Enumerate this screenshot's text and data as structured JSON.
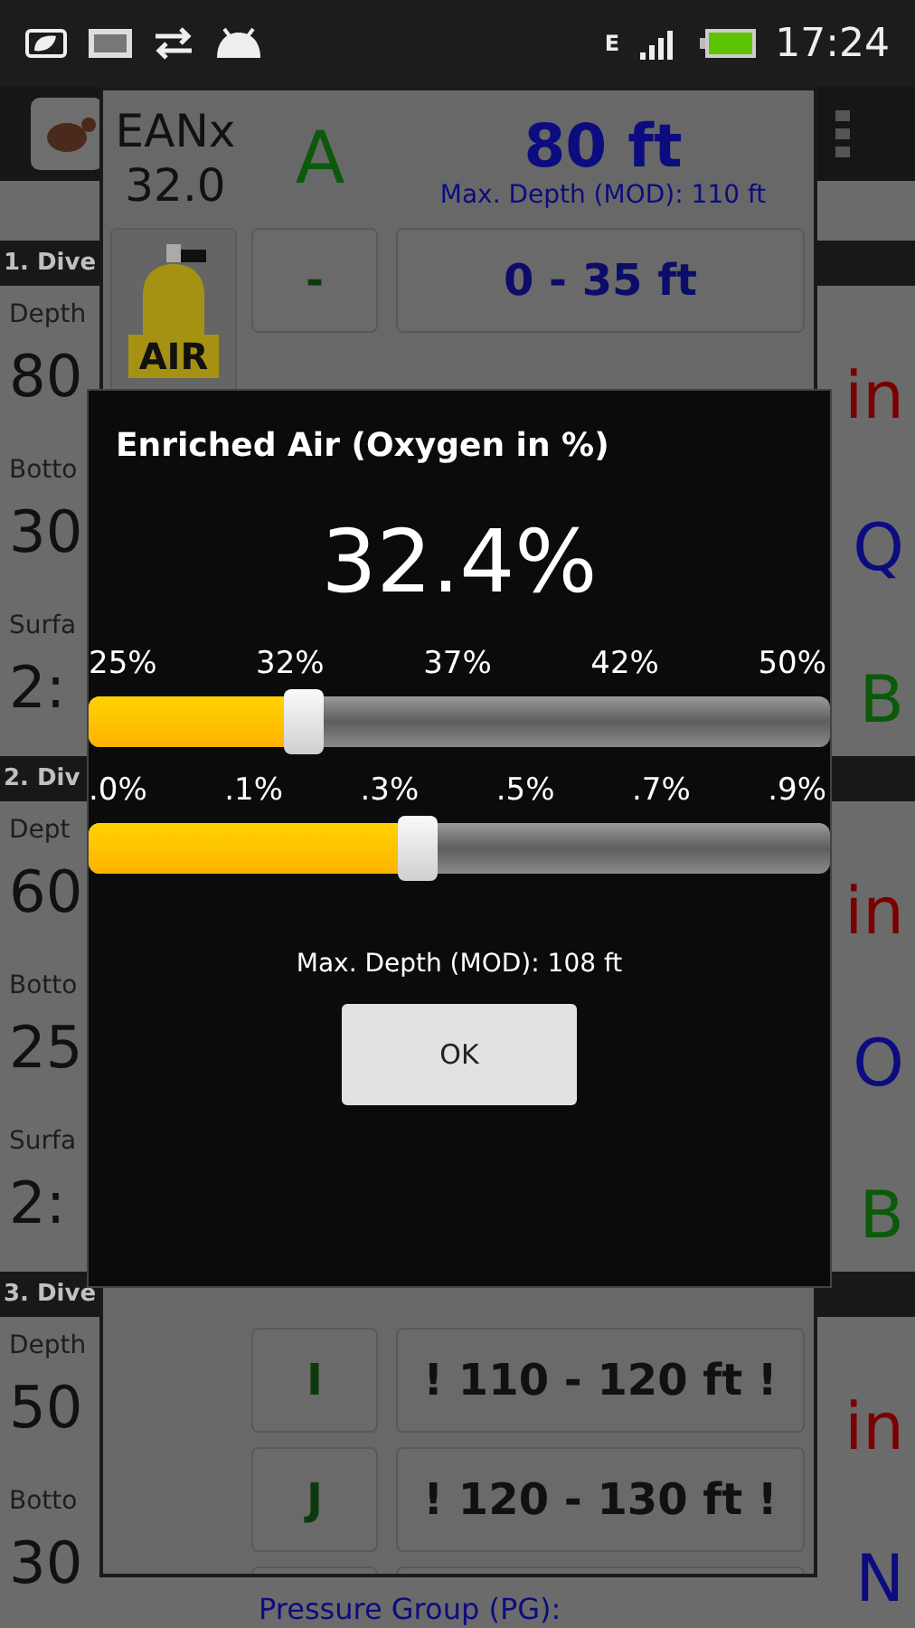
{
  "status_bar": {
    "time": "17:24",
    "network": "E"
  },
  "background": {
    "sections": [
      {
        "title": "1. Dive",
        "fields": [
          {
            "label": "Depth",
            "value": "80"
          },
          {
            "label": "Botto",
            "value": "30"
          },
          {
            "label": "Surfa",
            "value": "2:"
          }
        ],
        "side": [
          {
            "text": "in",
            "kind": "time"
          },
          {
            "text": "Q",
            "kind": "group"
          },
          {
            "text": "B",
            "kind": "letter"
          }
        ]
      },
      {
        "title": "2. Div",
        "fields": [
          {
            "label": "Dept",
            "value": "60"
          },
          {
            "label": "Botto",
            "value": "25"
          },
          {
            "label": "Surfa",
            "value": "2:"
          }
        ],
        "side": [
          {
            "text": "in",
            "kind": "time"
          },
          {
            "text": "O",
            "kind": "group"
          },
          {
            "text": "B",
            "kind": "letter"
          }
        ]
      },
      {
        "title": "3. Dive",
        "fields": [
          {
            "label": "Depth",
            "value": "50"
          },
          {
            "label": "Botto",
            "value": "30"
          }
        ],
        "side": [
          {
            "text": "in",
            "kind": "time"
          },
          {
            "text": "N",
            "kind": "group"
          }
        ],
        "note": "Pressure Group (PG):"
      }
    ]
  },
  "panel": {
    "gas": "EANx",
    "fraction": "32.0",
    "group": "A",
    "depth": "80 ft",
    "mod": "Max. Depth (MOD): 110 ft",
    "tank_label": "AIR",
    "rows": [
      {
        "letter": "-",
        "range": "0 - 35 ft"
      },
      {
        "letter": "I",
        "range": "! 110 - 120 ft !"
      },
      {
        "letter": "J",
        "range": "! 120 - 130 ft !"
      }
    ]
  },
  "dialog": {
    "title": "Enriched Air (Oxygen in %)",
    "value": "32.4%",
    "sliders": [
      {
        "ticks": [
          "25%",
          "32%",
          "37%",
          "42%",
          "50%"
        ],
        "level": 0.29
      },
      {
        "ticks": [
          ".0%",
          ".1%",
          ".3%",
          ".5%",
          ".7%",
          ".9%"
        ],
        "level": 0.445
      }
    ],
    "mod": "Max. Depth (MOD): 108 ft",
    "button": "OK"
  }
}
